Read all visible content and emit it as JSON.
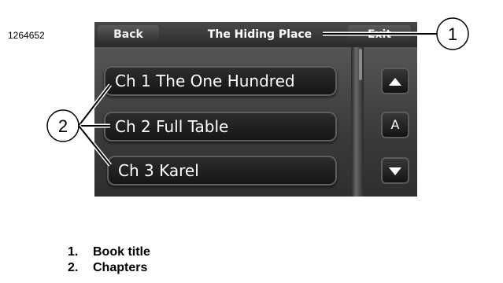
{
  "figure_id": "1264652",
  "screen": {
    "back_label": "Back",
    "title": "The Hiding Place",
    "exit_label": "Exit",
    "chapters": [
      {
        "label": "Ch 1 The One Hundred"
      },
      {
        "label": "Ch 2 Full Table"
      },
      {
        "label": "Ch 3 Karel"
      }
    ],
    "side_buttons": {
      "up_icon": "arrow-up-icon",
      "middle_label": "A",
      "down_icon": "arrow-down-icon"
    }
  },
  "callouts": [
    {
      "number": "1"
    },
    {
      "number": "2"
    }
  ],
  "legend": [
    {
      "number": "1.",
      "text": "Book title"
    },
    {
      "number": "2.",
      "text": "Chapters"
    }
  ]
}
